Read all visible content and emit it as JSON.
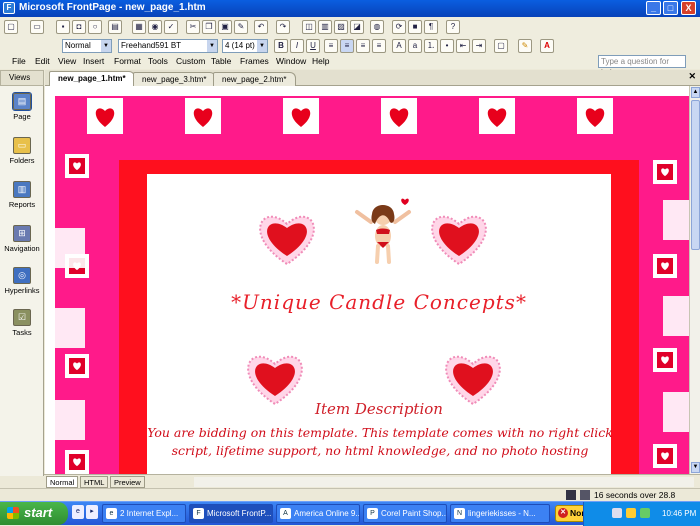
{
  "window": {
    "title": "Microsoft FrontPage - new_page_1.htm",
    "min": "_",
    "max": "□",
    "close": "X"
  },
  "format": {
    "style": "Normal",
    "font": "Freehand591 BT",
    "size": "4  (14 pt)"
  },
  "menu": [
    "File",
    "Edit",
    "View",
    "Insert",
    "Format",
    "Tools",
    "Custom",
    "Table",
    "Frames",
    "Window",
    "Help"
  ],
  "help_placeholder": "Type a question for help",
  "views": {
    "header": "Views",
    "items": [
      "Page",
      "Folders",
      "Reports",
      "Navigation",
      "Hyperlinks",
      "Tasks"
    ]
  },
  "tabs": [
    "new_page_1.htm*",
    "new_page_3.htm*",
    "new_page_2.htm*"
  ],
  "page": {
    "title": "*Unique Candle Concepts*",
    "item_heading": "Item Description",
    "desc_line1": "You are bidding on this template. This template comes with no right click",
    "desc_line2": "script, lifetime support, no html knowledge, and no photo hosting"
  },
  "viewtabs": [
    "Normal",
    "HTML",
    "Preview"
  ],
  "status": "16 seconds over 28.8",
  "taskbar": {
    "start": "start",
    "buttons": [
      "2 Internet Expl...",
      "Microsoft FrontP...",
      "America Online 9...",
      "Corel Paint Shop...",
      "lingeriekisses - N..."
    ],
    "norton": "Norton",
    "clock": "10:46 PM"
  },
  "colors": {
    "pink": "#ff1a8a",
    "red": "#ff0f1e",
    "title": "#e8202a"
  }
}
